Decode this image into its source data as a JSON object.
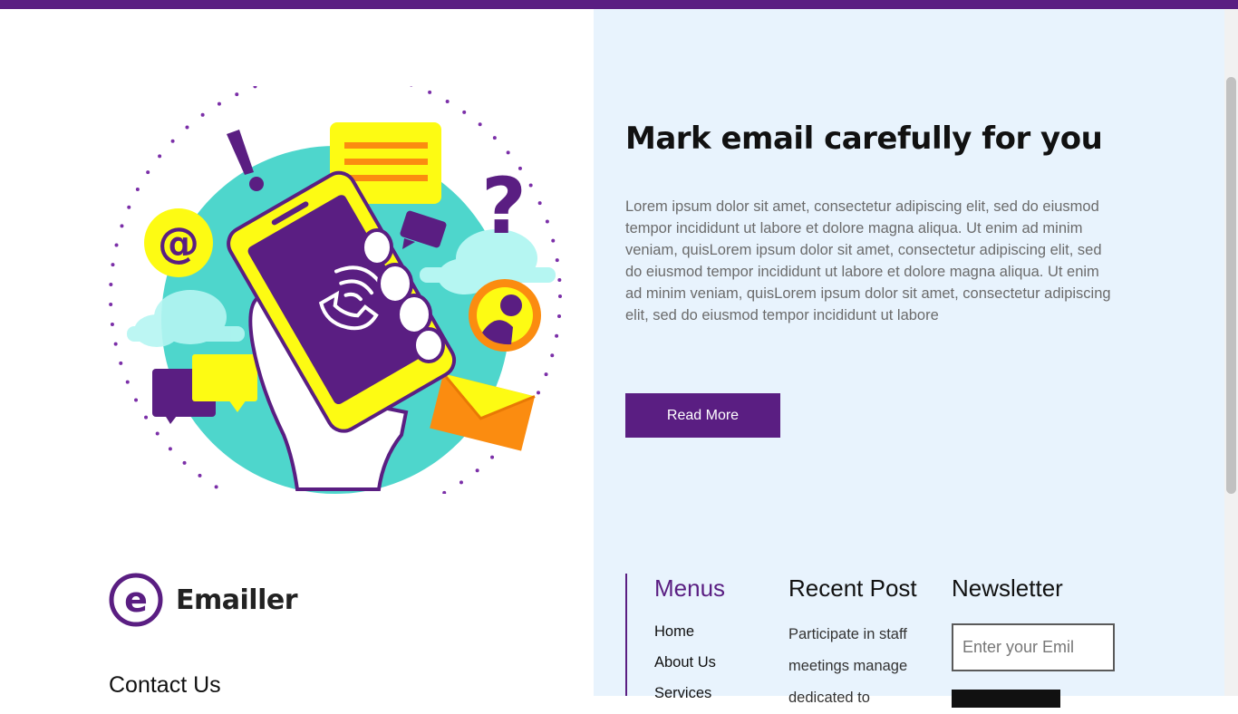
{
  "hero": {
    "title": "Mark email carefully for you",
    "body": "Lorem ipsum dolor sit amet, consectetur adipiscing elit, sed do eiusmod tempor incididunt ut labore et dolore magna aliqua. Ut enim ad minim veniam, quisLorem ipsum dolor sit amet, consectetur adipiscing elit, sed do eiusmod tempor incididunt ut labore et dolore magna aliqua. Ut enim ad minim veniam, quisLorem ipsum dolor sit amet, consectetur adipiscing elit, sed do eiusmod tempor incididunt ut labore",
    "read_more_label": "Read More"
  },
  "brand": {
    "logo_letter": "e",
    "name": "Emailler"
  },
  "footer": {
    "contact_title": "Contact Us",
    "menus": {
      "title": "Menus",
      "items": [
        "Home",
        "About Us",
        "Services"
      ]
    },
    "recent_post": {
      "title": "Recent Post",
      "text": "Participate in staff meetings manage dedicated to"
    },
    "newsletter": {
      "title": "Newsletter",
      "placeholder": "Enter your Emil"
    }
  },
  "illustration": {
    "at_symbol": "@",
    "question_mark": "?",
    "exclamation": "!"
  },
  "colors": {
    "primary": "#5a1e82",
    "panel_bg": "#e8f3fd",
    "teal": "#4ed6cc",
    "yellow": "#fdfb13",
    "orange": "#fb8c10"
  }
}
